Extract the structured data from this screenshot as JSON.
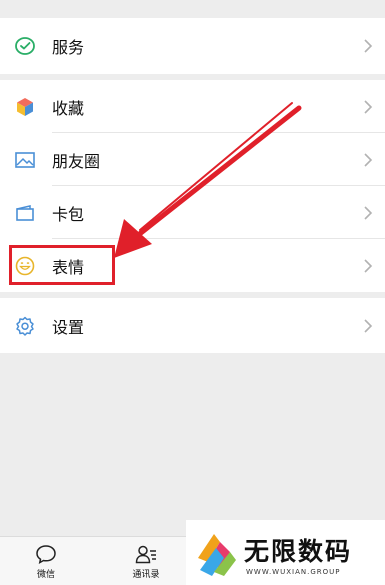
{
  "menu": {
    "service": {
      "label": "服务",
      "icon": "wechat-pay-icon"
    },
    "favorites": {
      "label": "收藏",
      "icon": "cube-icon"
    },
    "moments": {
      "label": "朋友圈",
      "icon": "picture-icon"
    },
    "cards": {
      "label": "卡包",
      "icon": "card-icon"
    },
    "stickers": {
      "label": "表情",
      "icon": "smiley-icon"
    },
    "settings": {
      "label": "设置",
      "icon": "gear-icon"
    }
  },
  "tabbar": {
    "tabs": [
      {
        "label": "微信",
        "icon": "chat-bubble-icon"
      },
      {
        "label": "通讯录",
        "icon": "contacts-icon"
      }
    ]
  },
  "watermark": {
    "brand": "无限数码",
    "url": "WWW.WUXIAN.GROUP"
  },
  "colors": {
    "annotation": "#e0202a",
    "background": "#ededed",
    "chevron": "#b2b2b2",
    "icon_blue": "#4a8fd6",
    "icon_yellow": "#e8b52b",
    "icon_green": "#2aae67"
  }
}
